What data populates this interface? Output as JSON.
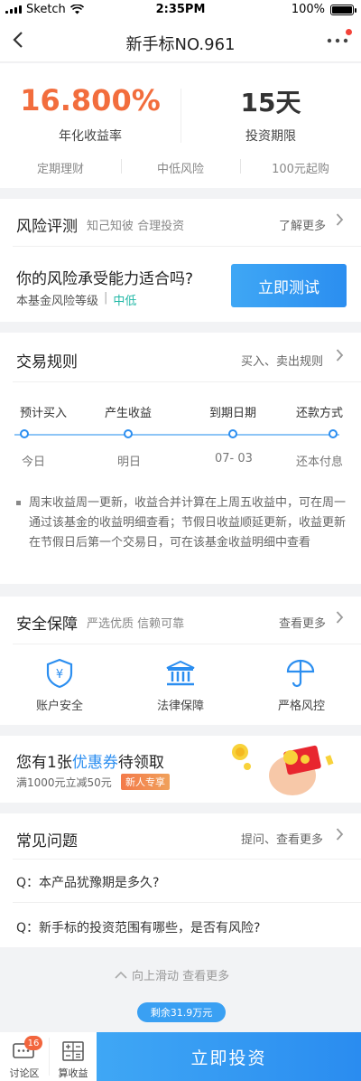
{
  "status_bar": {
    "carrier": "Sketch",
    "time": "2:35PM",
    "battery": "100%"
  },
  "nav": {
    "title": "新手标NO.961"
  },
  "summary": {
    "rate": "16.800%",
    "rate_label": "年化收益率",
    "term": "15天",
    "term_label": "投资期限",
    "tags": [
      "定期理财",
      "中低风险",
      "100元起购"
    ]
  },
  "risk": {
    "title": "风险评测",
    "subtitle": "知己知彼 合理投资",
    "more": "了解更多",
    "question": "你的风险承受能力适合吗?",
    "level_label": "本基金风险等级",
    "level_value": "中低",
    "button": "立即测试"
  },
  "rules": {
    "title": "交易规则",
    "more": "买入、卖出规则",
    "steps": [
      {
        "label": "预计买入",
        "value": "今日"
      },
      {
        "label": "产生收益",
        "value": "明日"
      },
      {
        "label": "到期日期",
        "value": "07- 03"
      },
      {
        "label": "还款方式",
        "value": "还本付息"
      }
    ],
    "note": "周末收益周一更新，收益合并计算在上周五收益中，可在周一通过该基金的收益明细查看；节假日收益顺延更新，收益更新在节假日后第一个交易日，可在该基金收益明细中查看"
  },
  "security": {
    "title": "安全保障",
    "subtitle": "严选优质 信赖可靠",
    "more": "查看更多",
    "items": [
      "账户安全",
      "法律保障",
      "严格风控"
    ]
  },
  "coupon": {
    "prefix": "您有1张",
    "highlight": "优惠券",
    "suffix": "待领取",
    "desc": "满1000元立减50元",
    "tag": "新人专享"
  },
  "faq": {
    "title": "常见问题",
    "more": "提问、查看更多",
    "items": [
      "Q：本产品犹豫期是多久?",
      "Q：新手标的投资范围有哪些，是否有风险?"
    ]
  },
  "footer": {
    "scroll_hint": "向上滑动 查看更多",
    "remaining": "剩余31.9万元",
    "discuss": "讨论区",
    "discuss_count": "16",
    "calc": "算收益",
    "invest": "立即投资"
  },
  "colors": {
    "accent": "#2b8ef0",
    "rate": "#f26d3d",
    "risk_level": "#22b8a6"
  }
}
